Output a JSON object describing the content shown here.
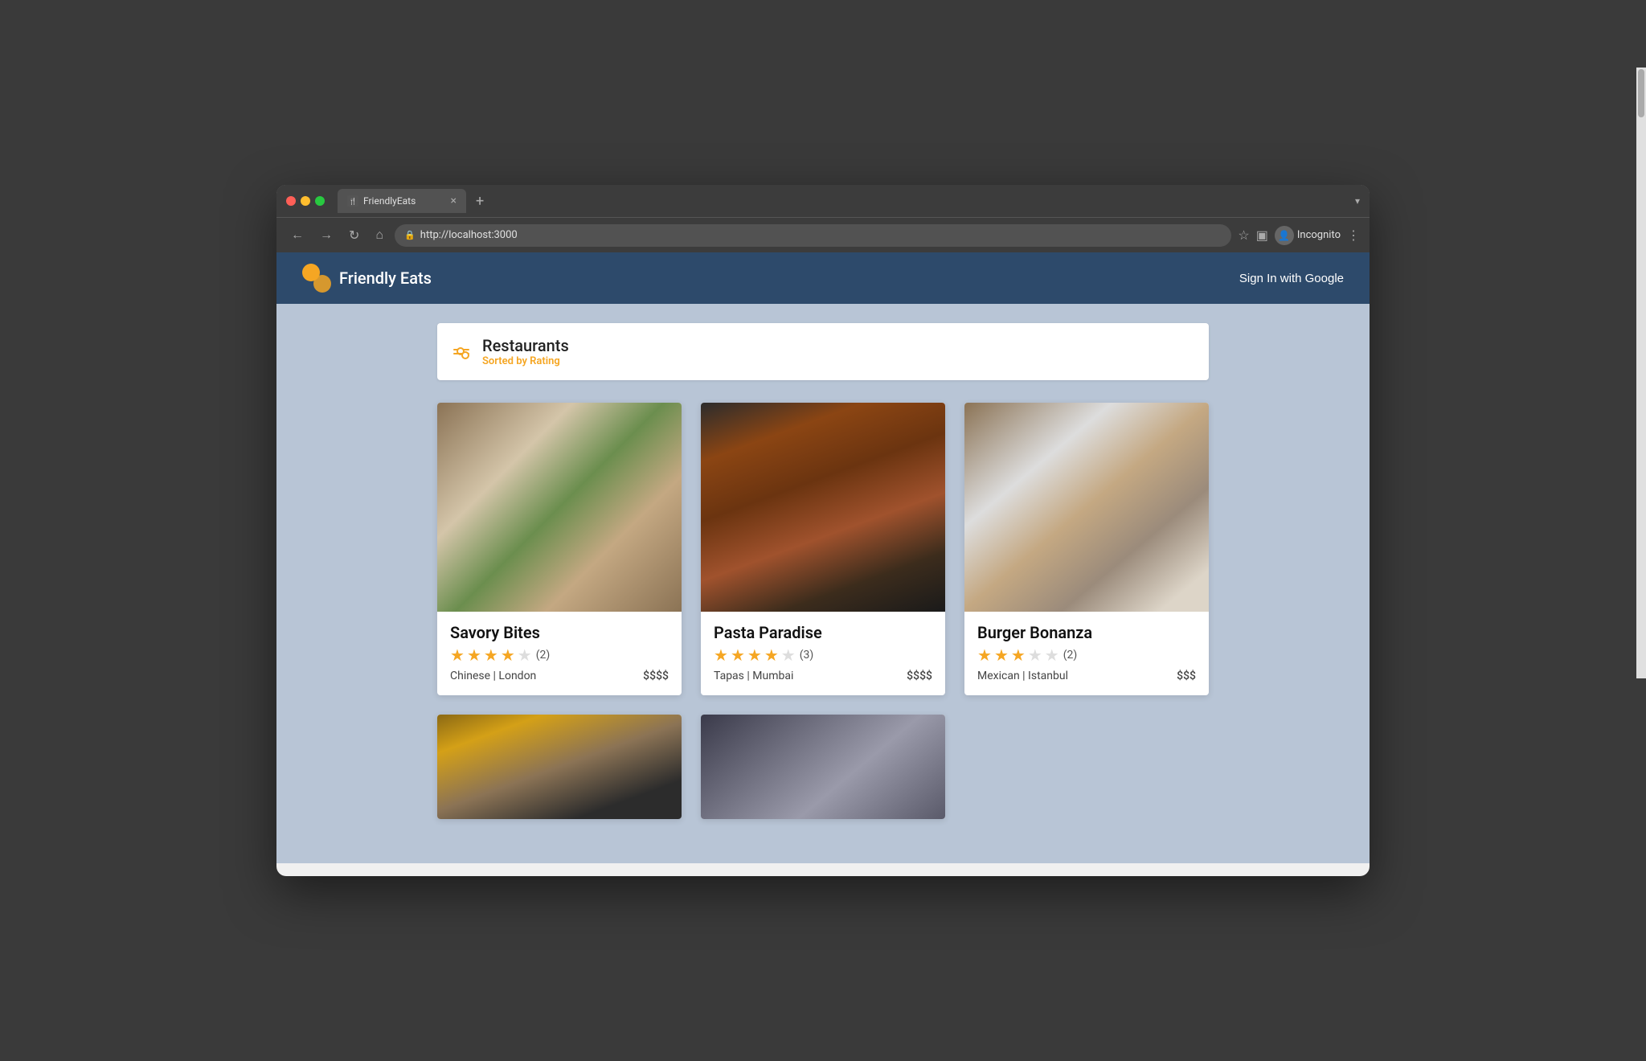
{
  "browser": {
    "tab_title": "FriendlyEats",
    "url": "http://localhost:3000",
    "new_tab_label": "+",
    "dropdown_label": "▾",
    "incognito_label": "Incognito",
    "more_label": "⋮"
  },
  "header": {
    "app_title": "Friendly Eats",
    "sign_in_label": "Sign In with Google"
  },
  "section": {
    "title": "Restaurants",
    "subtitle": "Sorted by Rating"
  },
  "restaurants": [
    {
      "name": "Savory Bites",
      "stars": [
        true,
        true,
        true,
        true,
        false
      ],
      "review_count": "(2)",
      "cuisine": "Chinese",
      "city": "London",
      "price": "$$$$",
      "img_class": "img-savory-bites"
    },
    {
      "name": "Pasta Paradise",
      "stars": [
        true,
        true,
        true,
        true,
        false
      ],
      "review_count": "(3)",
      "cuisine": "Tapas",
      "city": "Mumbai",
      "price": "$$$$",
      "img_class": "img-pasta-paradise"
    },
    {
      "name": "Burger Bonanza",
      "stars": [
        true,
        true,
        true,
        false,
        false
      ],
      "review_count": "(2)",
      "cuisine": "Mexican",
      "city": "Istanbul",
      "price": "$$$",
      "img_class": "img-burger-bonanza"
    },
    {
      "name": "",
      "stars": [],
      "review_count": "",
      "cuisine": "",
      "city": "",
      "price": "",
      "img_class": "img-burger2"
    },
    {
      "name": "",
      "stars": [],
      "review_count": "",
      "cuisine": "",
      "city": "",
      "price": "",
      "img_class": "img-restaurant5"
    }
  ]
}
